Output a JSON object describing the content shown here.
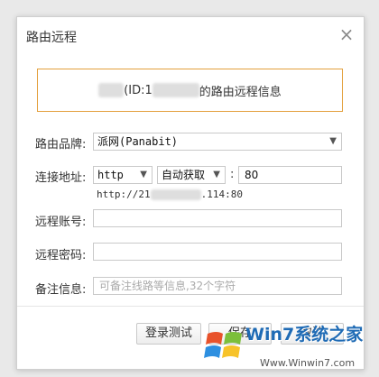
{
  "dialog": {
    "title": "路由远程",
    "close": "×"
  },
  "info": {
    "mid_text": "(ID:1",
    "suffix_text": "的路由远程信息"
  },
  "form": {
    "brand": {
      "label": "路由品牌:",
      "value": "派网(Panabit)"
    },
    "address": {
      "label": "连接地址:",
      "protocol": "http",
      "mode": "自动获取",
      "colon": ":",
      "port": "80",
      "hint_prefix": "http://21",
      "hint_suffix": ".114:80"
    },
    "account": {
      "label": "远程账号:",
      "value": ""
    },
    "password": {
      "label": "远程密码:",
      "value": ""
    },
    "note": {
      "label": "备注信息:",
      "placeholder": "可备注线路等信息,32个字符"
    }
  },
  "buttons": {
    "test": "登录测试",
    "save": "保存",
    "cancel": "取消"
  },
  "watermark": {
    "brand": "Win7系统之家",
    "url": "Www.Winwin7.com"
  },
  "colors": {
    "info_border": "#e3a03c",
    "watermark_blue": "#1f6bb5"
  }
}
